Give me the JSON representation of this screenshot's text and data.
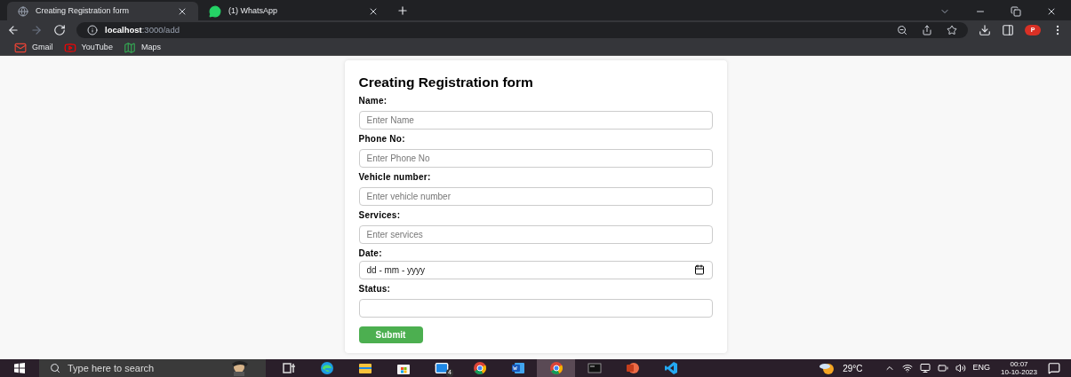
{
  "browser": {
    "tabs": [
      {
        "kind": "globe",
        "title": "Creating Registration form",
        "selected": true
      },
      {
        "kind": "whatsapp",
        "title": "(1) WhatsApp",
        "selected": false
      }
    ],
    "url": {
      "host": "localhost",
      "path": ":3000/add"
    },
    "profile": "P",
    "bookmarks": [
      {
        "kind": "gmail",
        "label": "Gmail"
      },
      {
        "kind": "youtube",
        "label": "YouTube"
      },
      {
        "kind": "maps",
        "label": "Maps"
      }
    ]
  },
  "form": {
    "title": "Creating Registration form",
    "fields": [
      {
        "kind": "text",
        "label": "Name:",
        "placeholder": "Enter Name"
      },
      {
        "kind": "text",
        "label": "Phone No:",
        "placeholder": "Enter Phone No"
      },
      {
        "kind": "text",
        "label": "Vehicle number:",
        "placeholder": "Enter vehicle number"
      },
      {
        "kind": "text",
        "label": "Services:",
        "placeholder": "Enter services"
      },
      {
        "kind": "date",
        "label": "Date:",
        "placeholder": "dd - mm - yyyy"
      },
      {
        "kind": "text",
        "label": "Status:"
      }
    ],
    "submit": "Submit"
  },
  "taskbar": {
    "search_placeholder": "Type here to search",
    "apps": [
      {
        "kind": "taskview",
        "selected": false
      },
      {
        "kind": "edge",
        "selected": false
      },
      {
        "kind": "explorer",
        "selected": false
      },
      {
        "kind": "store",
        "selected": false
      },
      {
        "kind": "mail",
        "selected": false,
        "badge": "4"
      },
      {
        "kind": "chrome",
        "selected": false
      },
      {
        "kind": "word",
        "selected": false
      },
      {
        "kind": "chrome",
        "selected": true
      },
      {
        "kind": "terminal",
        "selected": false
      },
      {
        "kind": "powerpoint",
        "selected": false
      },
      {
        "kind": "vscode",
        "selected": false
      }
    ],
    "temperature": "29°C",
    "language": "ENG",
    "time": "00:07",
    "date": "10-10-2023"
  }
}
